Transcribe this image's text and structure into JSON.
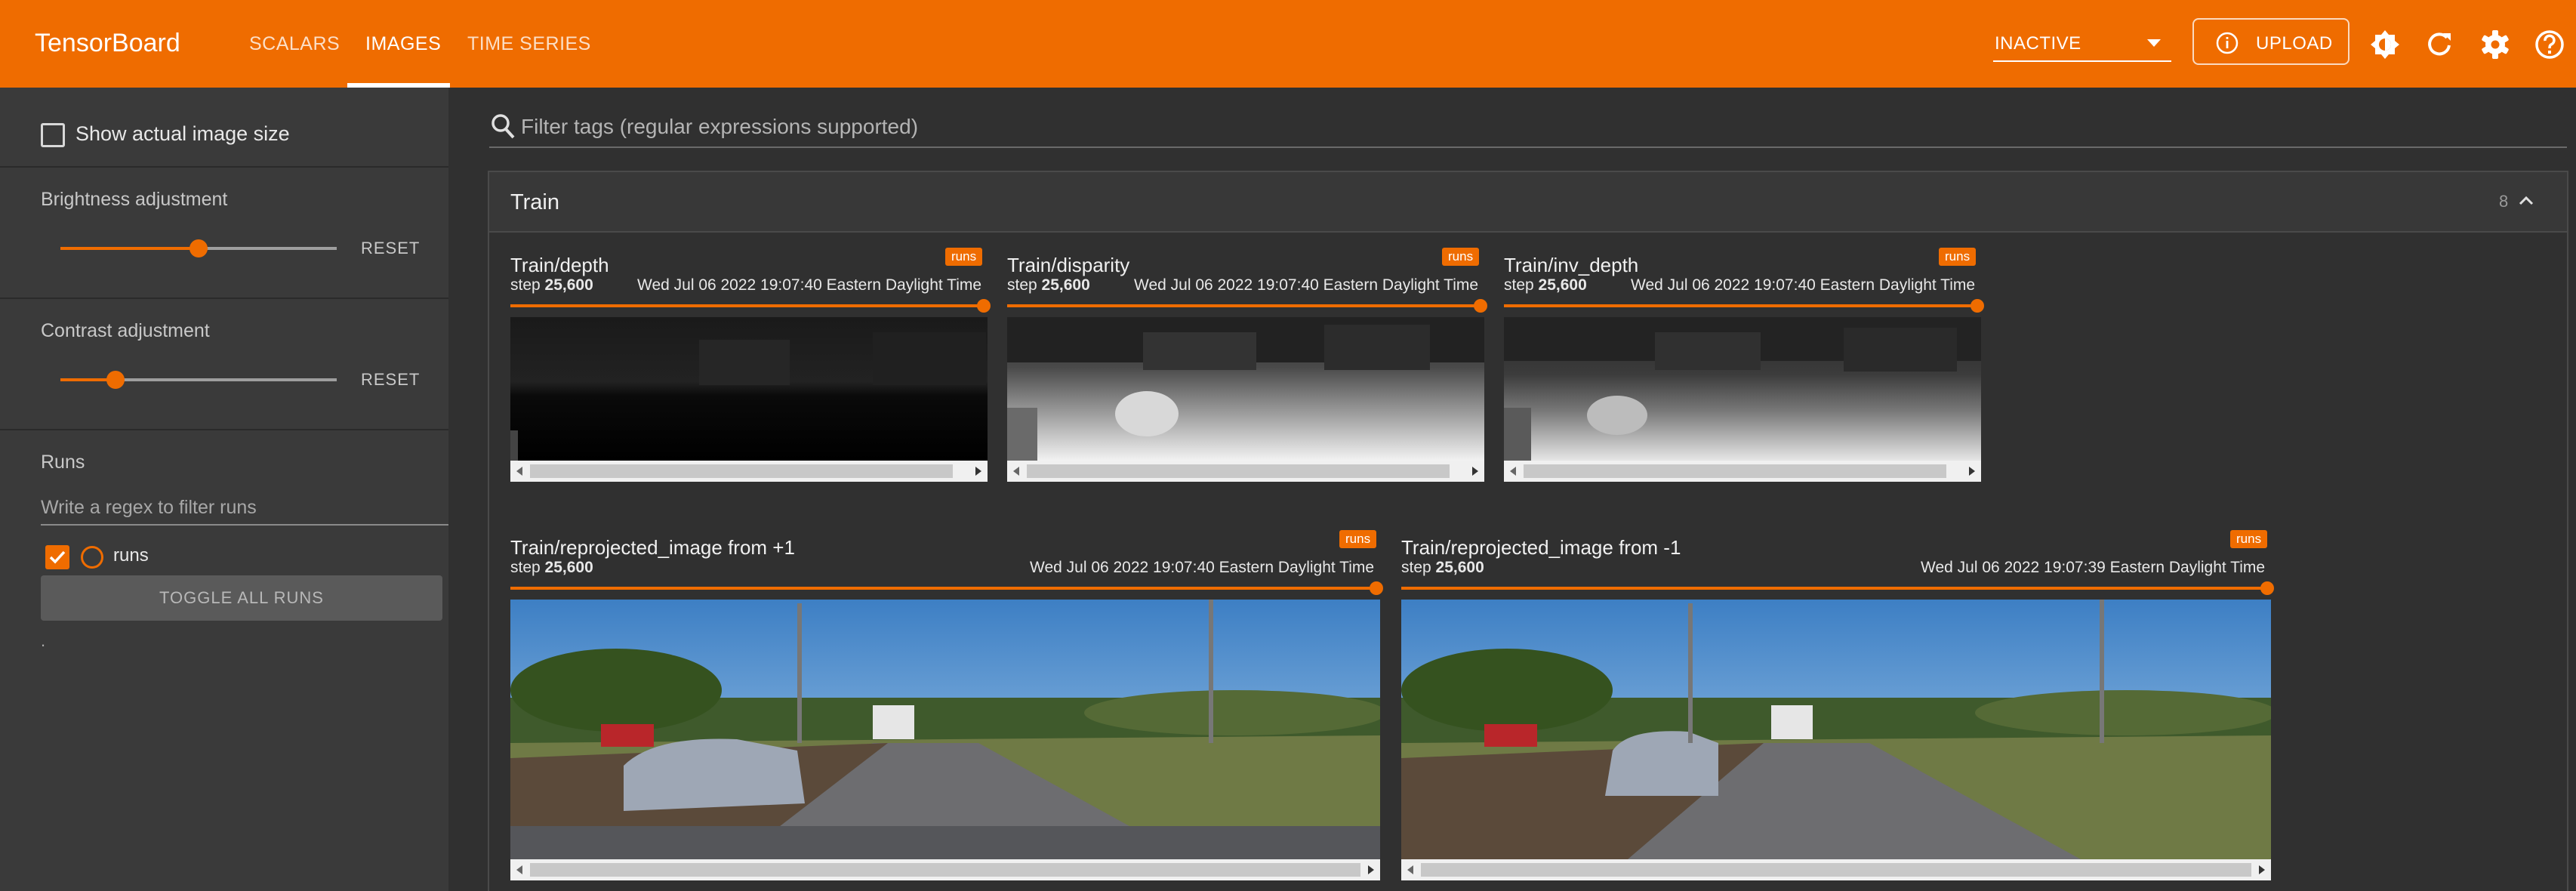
{
  "app": {
    "title": "TensorBoard"
  },
  "nav": {
    "tabs": [
      {
        "label": "SCALARS"
      },
      {
        "label": "IMAGES"
      },
      {
        "label": "TIME SERIES"
      }
    ]
  },
  "toolbar": {
    "status_select": "INACTIVE",
    "upload_label": "UPLOAD",
    "icons": [
      "brightness-icon",
      "refresh-icon",
      "settings-icon",
      "help-icon"
    ]
  },
  "sidebar": {
    "show_actual_size_label": "Show actual image size",
    "show_actual_size_checked": false,
    "brightness": {
      "label": "Brightness adjustment",
      "reset_label": "RESET",
      "value_fraction": 0.5
    },
    "contrast": {
      "label": "Contrast adjustment",
      "reset_label": "RESET",
      "value_fraction": 0.2
    },
    "runs": {
      "title": "Runs",
      "filter_placeholder": "Write a regex to filter runs",
      "items": [
        {
          "name": "runs",
          "checked": true,
          "color": "#ef6c00"
        }
      ],
      "toggle_all_label": "TOGGLE ALL RUNS",
      "footnote": "."
    }
  },
  "main": {
    "filter_placeholder": "Filter tags (regular expressions supported)",
    "card": {
      "title": "Train",
      "count": "8",
      "panes": [
        {
          "tag": "Train/depth",
          "run": "runs",
          "step_label": "step",
          "step": "25,600",
          "time": "Wed Jul 06 2022 19:07:40 Eastern Daylight Time"
        },
        {
          "tag": "Train/disparity",
          "run": "runs",
          "step_label": "step",
          "step": "25,600",
          "time": "Wed Jul 06 2022 19:07:40 Eastern Daylight Time"
        },
        {
          "tag": "Train/inv_depth",
          "run": "runs",
          "step_label": "step",
          "step": "25,600",
          "time": "Wed Jul 06 2022 19:07:40 Eastern Daylight Time"
        },
        {
          "tag": "Train/reprojected_image from +1",
          "run": "runs",
          "step_label": "step",
          "step": "25,600",
          "time": "Wed Jul 06 2022 19:07:40 Eastern Daylight Time"
        },
        {
          "tag": "Train/reprojected_image from -1",
          "run": "runs",
          "step_label": "step",
          "step": "25,600",
          "time": "Wed Jul 06 2022 19:07:39 Eastern Daylight Time"
        }
      ]
    }
  }
}
